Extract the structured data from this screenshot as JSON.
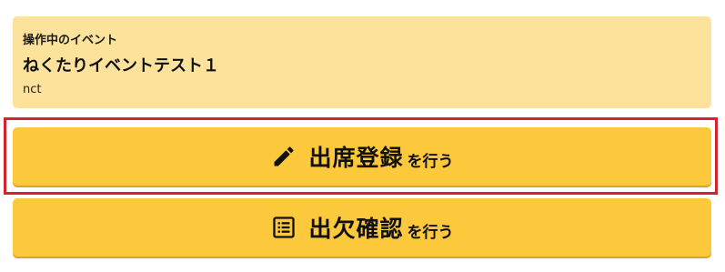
{
  "event_panel": {
    "caption": "操作中のイベント",
    "name": "ねくたりイベントテスト１",
    "code": "nct"
  },
  "actions": {
    "attendance_register": {
      "main_label": "出席登録",
      "suffix_label": "を行う",
      "icon": "pencil-icon"
    },
    "attendance_check": {
      "main_label": "出欠確認",
      "suffix_label": "を行う",
      "icon": "list-icon"
    }
  },
  "colors": {
    "panel_background": "#fde29b",
    "button_background": "#fcc83c",
    "highlight_border": "#d4252d"
  }
}
